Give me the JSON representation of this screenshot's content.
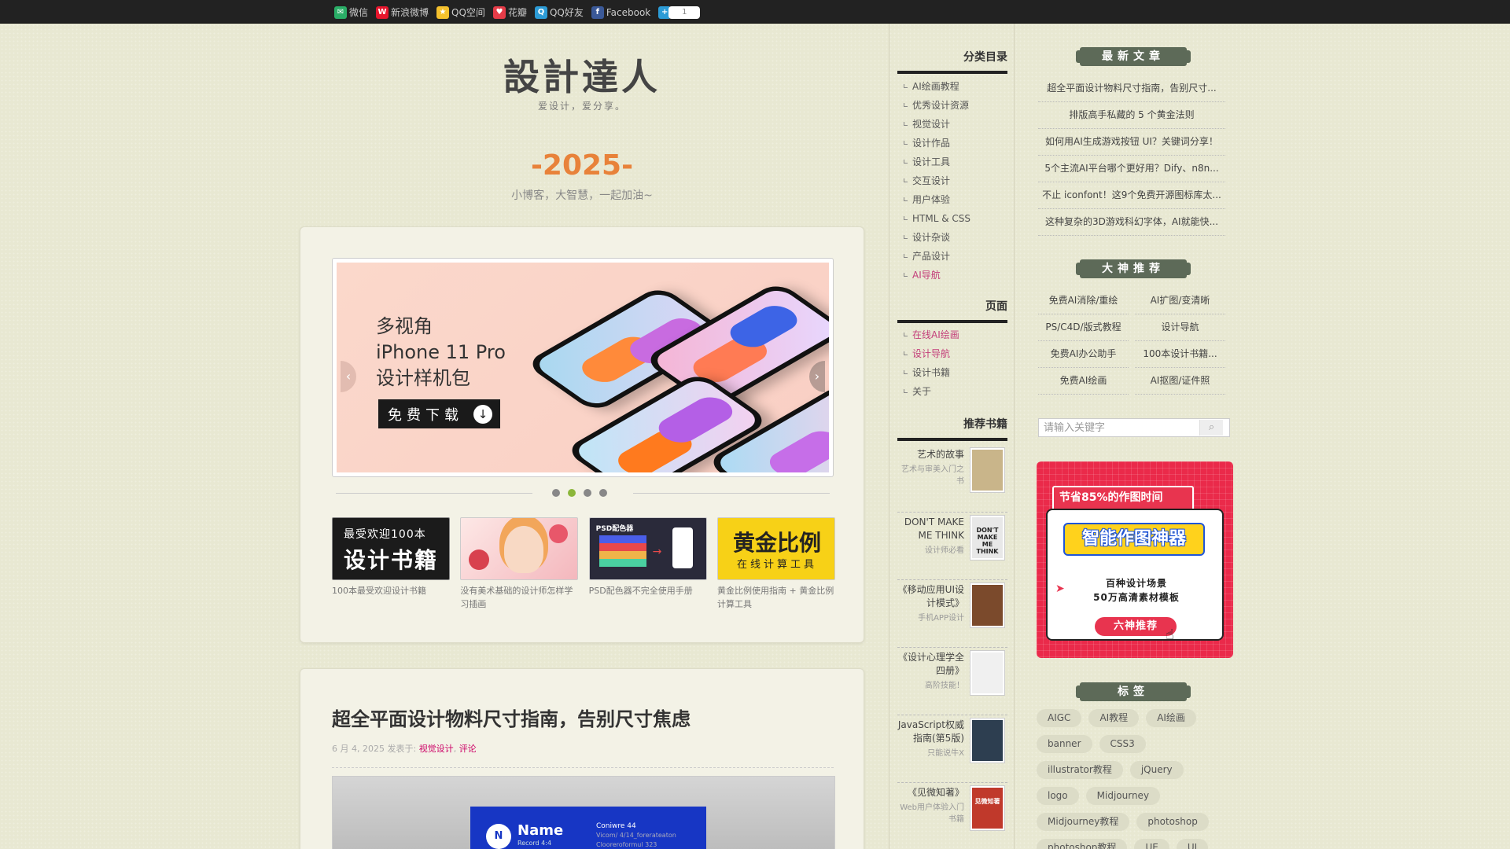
{
  "share": {
    "items": [
      {
        "label": "微信",
        "color": "#2aae67",
        "glyph": "✉"
      },
      {
        "label": "新浪微博",
        "color": "#e6162d",
        "glyph": "W"
      },
      {
        "label": "QQ空间",
        "color": "#f5c12d",
        "glyph": "★"
      },
      {
        "label": "花瓣",
        "color": "#e53c48",
        "glyph": "♥"
      },
      {
        "label": "QQ好友",
        "color": "#2c9bd6",
        "glyph": "Q"
      },
      {
        "label": "Facebook",
        "color": "#3b5998",
        "glyph": "f"
      }
    ],
    "plus_glyph": "+",
    "count": "1"
  },
  "header": {
    "title": "設計達人",
    "subtitle": "爱设计，爱分享。",
    "year": "-2025-",
    "slogan": "小博客，大智慧，一起加油~"
  },
  "slider": {
    "text_line1": "多视角",
    "text_line2": "iPhone 11 Pro",
    "text_line3": "设计样机包",
    "button": "免费下载",
    "prev": "‹",
    "next": "›",
    "active_dot": 1
  },
  "featured": [
    {
      "caption": "100本最受欢迎设计书籍",
      "img_line1": "最受欢迎100本",
      "img_line2": "设计书籍"
    },
    {
      "caption": "没有美术基础的设计师怎样学习插画"
    },
    {
      "caption": "PSD配色器不完全使用手册",
      "img_line1": "PSD配色器"
    },
    {
      "caption": "黄金比例使用指南 + 黄金比例计算工具",
      "img_line1": "黄金比例",
      "img_line2": "在线计算工具"
    }
  ],
  "post": {
    "title": "超全平面设计物料尺寸指南，告别尺寸焦虑",
    "date": "6 月 4, 2025 发表于:",
    "category": "视觉设计",
    "comment": "评论",
    "image_name": "Name",
    "image_name_sub": "Record 4:4",
    "image_right_line1": "Coniwre 44",
    "image_right_line2": "Vicom/ 4/14_forerateaton",
    "image_right_line3": "Clooreroformul 323"
  },
  "categories": {
    "title": "分类目录",
    "items": [
      "AI绘画教程",
      "优秀设计资源",
      "视觉设计",
      "设计作品",
      "设计工具",
      "交互设计",
      "用户体验",
      "HTML & CSS",
      "设计杂谈",
      "产品设计",
      "AI导航"
    ]
  },
  "pages": {
    "title": "页面",
    "items": [
      "在线AI绘画",
      "设计导航",
      "设计书籍",
      "关于"
    ]
  },
  "books": {
    "title": "推荐书籍",
    "items": [
      {
        "title": "艺术的故事",
        "sub": "艺术与审美入门之书",
        "color": "#c9b58a"
      },
      {
        "title": "DON'T MAKE ME THINK",
        "sub": "设计师必看",
        "color": "#e8e8e8",
        "cover_text": "DON'T MAKE ME THINK"
      },
      {
        "title": "《移动应用UI设计模式》",
        "sub": "手机APP设计",
        "color": "#7b4a2c"
      },
      {
        "title": "《设计心理学全四册》",
        "sub": "高阶技能！",
        "color": "#f0f0f0"
      },
      {
        "title": "JavaScript权威指南(第5版)",
        "sub": "只能说牛X",
        "color": "#2d3e50"
      },
      {
        "title": "《见微知著》",
        "sub": "Web用户体验入门书籍",
        "color": "#c0392b",
        "cover_text": "见微知著"
      }
    ]
  },
  "latest": {
    "title": "最新文章",
    "items": [
      "超全平面设计物料尺寸指南，告别尺寸...",
      "排版高手私藏的 5 个黄金法则",
      "如何用AI生成游戏按钮 UI？关键词分享！",
      "5个主流AI平台哪个更好用？Dify、n8n...",
      "不止 iconfont！这9个免费开源图标库太...",
      "这种复杂的3D游戏科幻字体，AI就能快..."
    ]
  },
  "recommend": {
    "title": "大神推荐",
    "items": [
      "免费AI消除/重绘",
      "AI扩图/变清晰",
      "PS/C4D/版式教程",
      "设计导航",
      "免费AI办公助手",
      "100本设计书籍...",
      "免费AI绘画",
      "AI抠图/证件照"
    ]
  },
  "search": {
    "placeholder": "请输入关键字",
    "button_icon": "search-icon"
  },
  "ad": {
    "top": "节省85%的作图时间",
    "badge": "智能作图神器",
    "line1": "百种设计场景",
    "line2": "50万高清素材模板",
    "button": "六神推荐"
  },
  "tags": {
    "title": "标签",
    "items": [
      "AIGC",
      "AI教程",
      "AI绘画",
      "banner",
      "CSS3",
      "illustrator教程",
      "jQuery",
      "logo",
      "Midjourney",
      "Midjourney教程",
      "photoshop",
      "photoshop教程",
      "UE",
      "UI"
    ]
  },
  "colors": {
    "accent": "#e8823a",
    "pink": "#c33e7a",
    "header_badge": "#5d6a58"
  }
}
